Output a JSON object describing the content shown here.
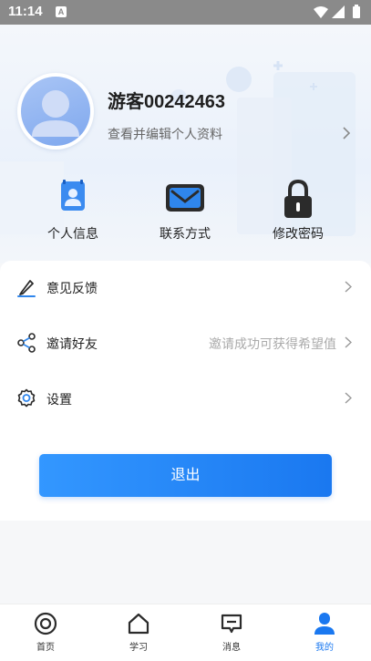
{
  "status_bar": {
    "time": "11:14",
    "notif_letter": "A"
  },
  "profile": {
    "username": "游客00242463",
    "edit_link": "查看并编辑个人资料"
  },
  "quick_actions": [
    {
      "label": "个人信息",
      "icon": "id-card-icon"
    },
    {
      "label": "联系方式",
      "icon": "mail-icon"
    },
    {
      "label": "修改密码",
      "icon": "lock-icon"
    }
  ],
  "menu": [
    {
      "label": "意见反馈",
      "icon": "pen-icon",
      "hint": ""
    },
    {
      "label": "邀请好友",
      "icon": "share-icon",
      "hint": "邀请成功可获得希望值"
    },
    {
      "label": "设置",
      "icon": "gear-icon",
      "hint": ""
    }
  ],
  "logout_label": "退出",
  "tabs": [
    {
      "label": "首页",
      "icon": "home-ring-icon",
      "active": false
    },
    {
      "label": "学习",
      "icon": "house-icon",
      "active": false
    },
    {
      "label": "消息",
      "icon": "message-icon",
      "active": false
    },
    {
      "label": "我的",
      "icon": "user-icon",
      "active": true
    }
  ],
  "colors": {
    "accent": "#1a78f0",
    "status_bar": "#8a8a8a"
  }
}
